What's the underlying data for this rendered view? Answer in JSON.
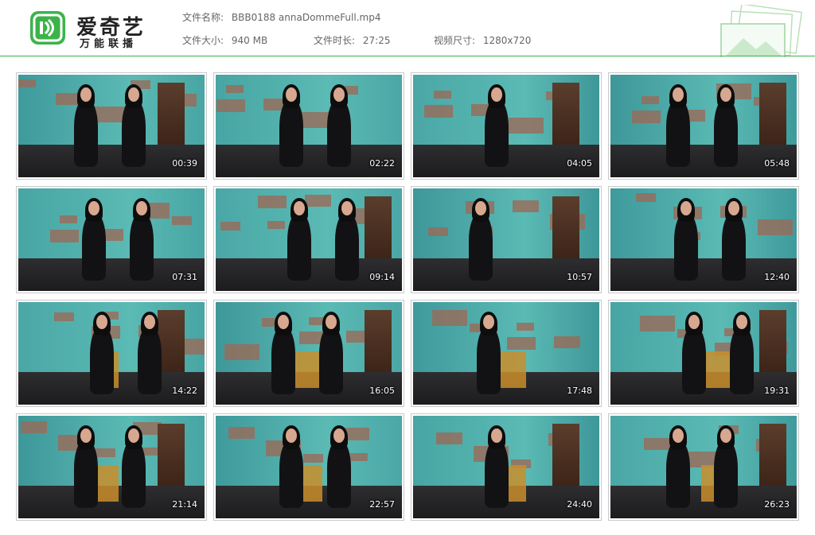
{
  "header": {
    "brand_name": "爱奇艺",
    "brand_sub": "万能联播",
    "file_name_label": "文件名称:",
    "file_name": "BBB0188 annaDommeFull.mp4",
    "file_size_label": "文件大小:",
    "file_size": "940 MB",
    "duration_label": "文件时长:",
    "duration": "27:25",
    "resolution_label": "视频尺寸:",
    "resolution": "1280x720",
    "accent_color": "#3cb34a"
  },
  "thumbnails": [
    {
      "timestamp": "00:39"
    },
    {
      "timestamp": "02:22"
    },
    {
      "timestamp": "04:05"
    },
    {
      "timestamp": "05:48"
    },
    {
      "timestamp": "07:31"
    },
    {
      "timestamp": "09:14"
    },
    {
      "timestamp": "10:57"
    },
    {
      "timestamp": "12:40"
    },
    {
      "timestamp": "14:22"
    },
    {
      "timestamp": "16:05"
    },
    {
      "timestamp": "17:48"
    },
    {
      "timestamp": "19:31"
    },
    {
      "timestamp": "21:14"
    },
    {
      "timestamp": "22:57"
    },
    {
      "timestamp": "24:40"
    },
    {
      "timestamp": "26:23"
    }
  ]
}
